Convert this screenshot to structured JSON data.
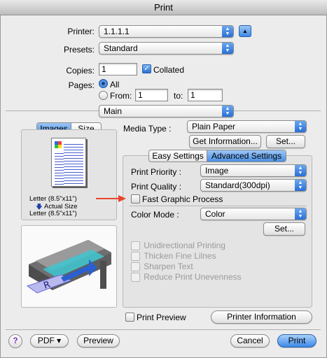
{
  "window": {
    "title": "Print"
  },
  "top": {
    "printer_label": "Printer:",
    "printer_value": "1.1.1.1",
    "presets_label": "Presets:",
    "presets_value": "Standard",
    "copies_label": "Copies:",
    "copies_value": "1",
    "collated_label": "Collated",
    "collated_checked": true,
    "pages_label": "Pages:",
    "pages_all_label": "All",
    "pages_from_label": "From:",
    "pages_from_value": "1",
    "pages_to_label": "to:",
    "pages_to_value": "1",
    "pane_value": "Main"
  },
  "preview_panel": {
    "tabs": [
      "Images",
      "Size"
    ],
    "paper_label_1": "Letter (8.5\"x11\")",
    "actual_size_label": "Actual Size",
    "paper_label_2": "Letter (8.5\"x11\")"
  },
  "main": {
    "media_type_label": "Media Type :",
    "media_type_value": "Plain Paper",
    "get_info_button": "Get Information...",
    "set_button": "Set...",
    "tabs": [
      "Easy Settings",
      "Advanced Settings"
    ],
    "print_priority_label": "Print Priority :",
    "print_priority_value": "Image",
    "print_quality_label": "Print Quality :",
    "print_quality_value": "Standard(300dpi)",
    "fast_graphic_label": "Fast Graphic Process",
    "color_mode_label": "Color Mode :",
    "color_mode_value": "Color",
    "set_button_2": "Set...",
    "options": [
      "Unidirectional Printing",
      "Thicken Fine Lilnes",
      "Sharpen Text",
      "Reduce Print Unevenness"
    ],
    "print_preview_label": "Print Preview",
    "printer_info_button": "Printer Information"
  },
  "bottom": {
    "help_label": "?",
    "pdf_button": "PDF ▾",
    "preview_button": "Preview",
    "cancel_button": "Cancel",
    "print_button": "Print"
  },
  "colors": {
    "accent": "#3d8ae8",
    "annotation_arrow": "#e8442a"
  }
}
